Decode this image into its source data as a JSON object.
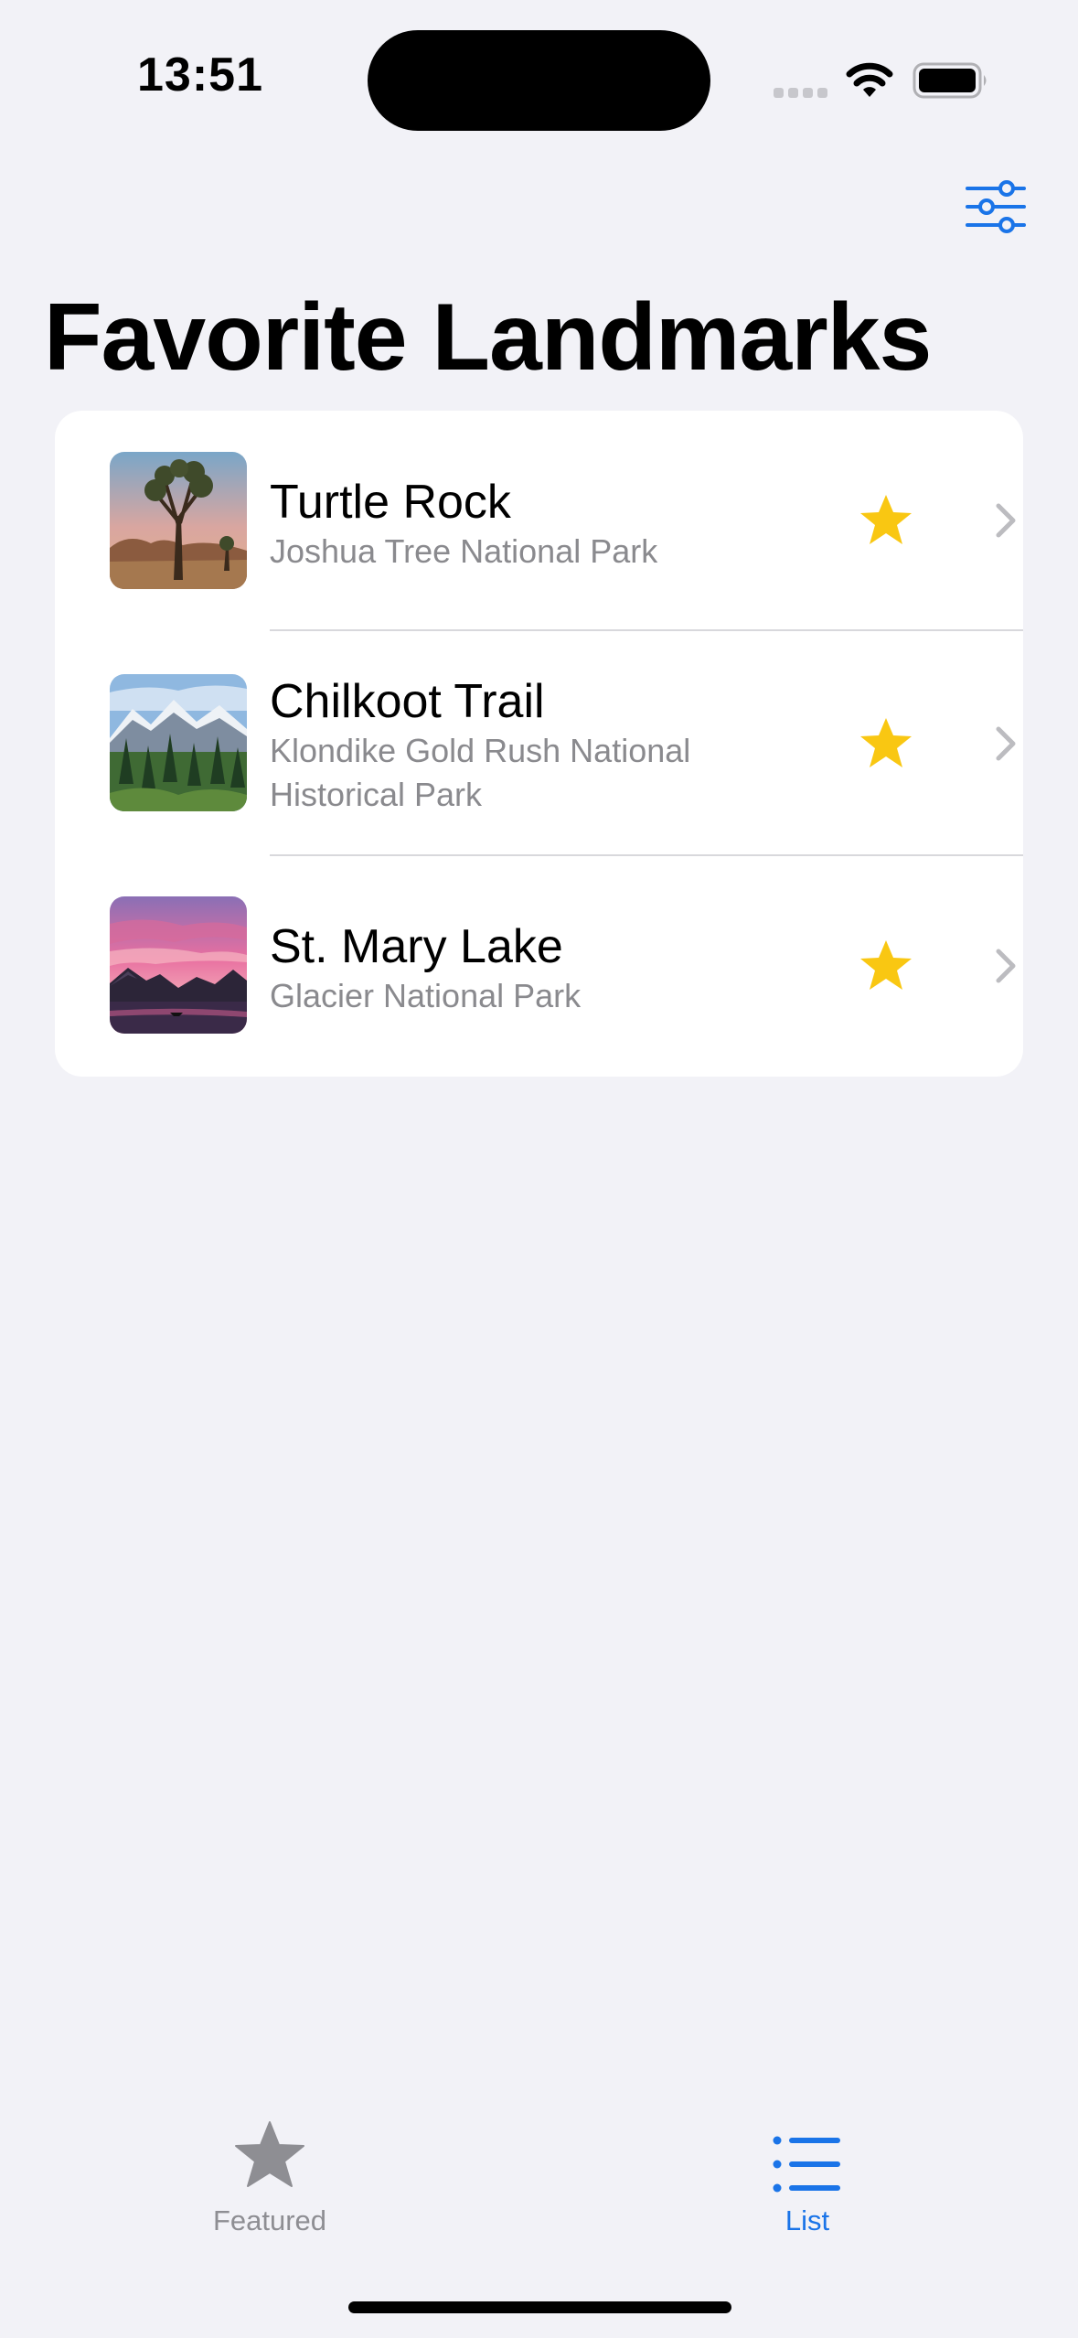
{
  "status_bar": {
    "time": "13:51"
  },
  "toolbar": {
    "filter_icon": "slider-horizontal-icon"
  },
  "title": "Favorite Landmarks",
  "colors": {
    "accent": "#1a74e8",
    "star": "#f9c712",
    "secondary_text": "#8a8a8e",
    "background": "#f2f2f7"
  },
  "landmarks": [
    {
      "name": "Turtle Rock",
      "park": "Joshua Tree National Park",
      "favorite": true
    },
    {
      "name": "Chilkoot Trail",
      "park": "Klondike Gold Rush National Historical Park",
      "favorite": true
    },
    {
      "name": "St. Mary Lake",
      "park": "Glacier National Park",
      "favorite": true
    }
  ],
  "tabs": [
    {
      "label": "Featured",
      "icon": "star-icon",
      "selected": false
    },
    {
      "label": "List",
      "icon": "list-bullet-icon",
      "selected": true
    }
  ]
}
